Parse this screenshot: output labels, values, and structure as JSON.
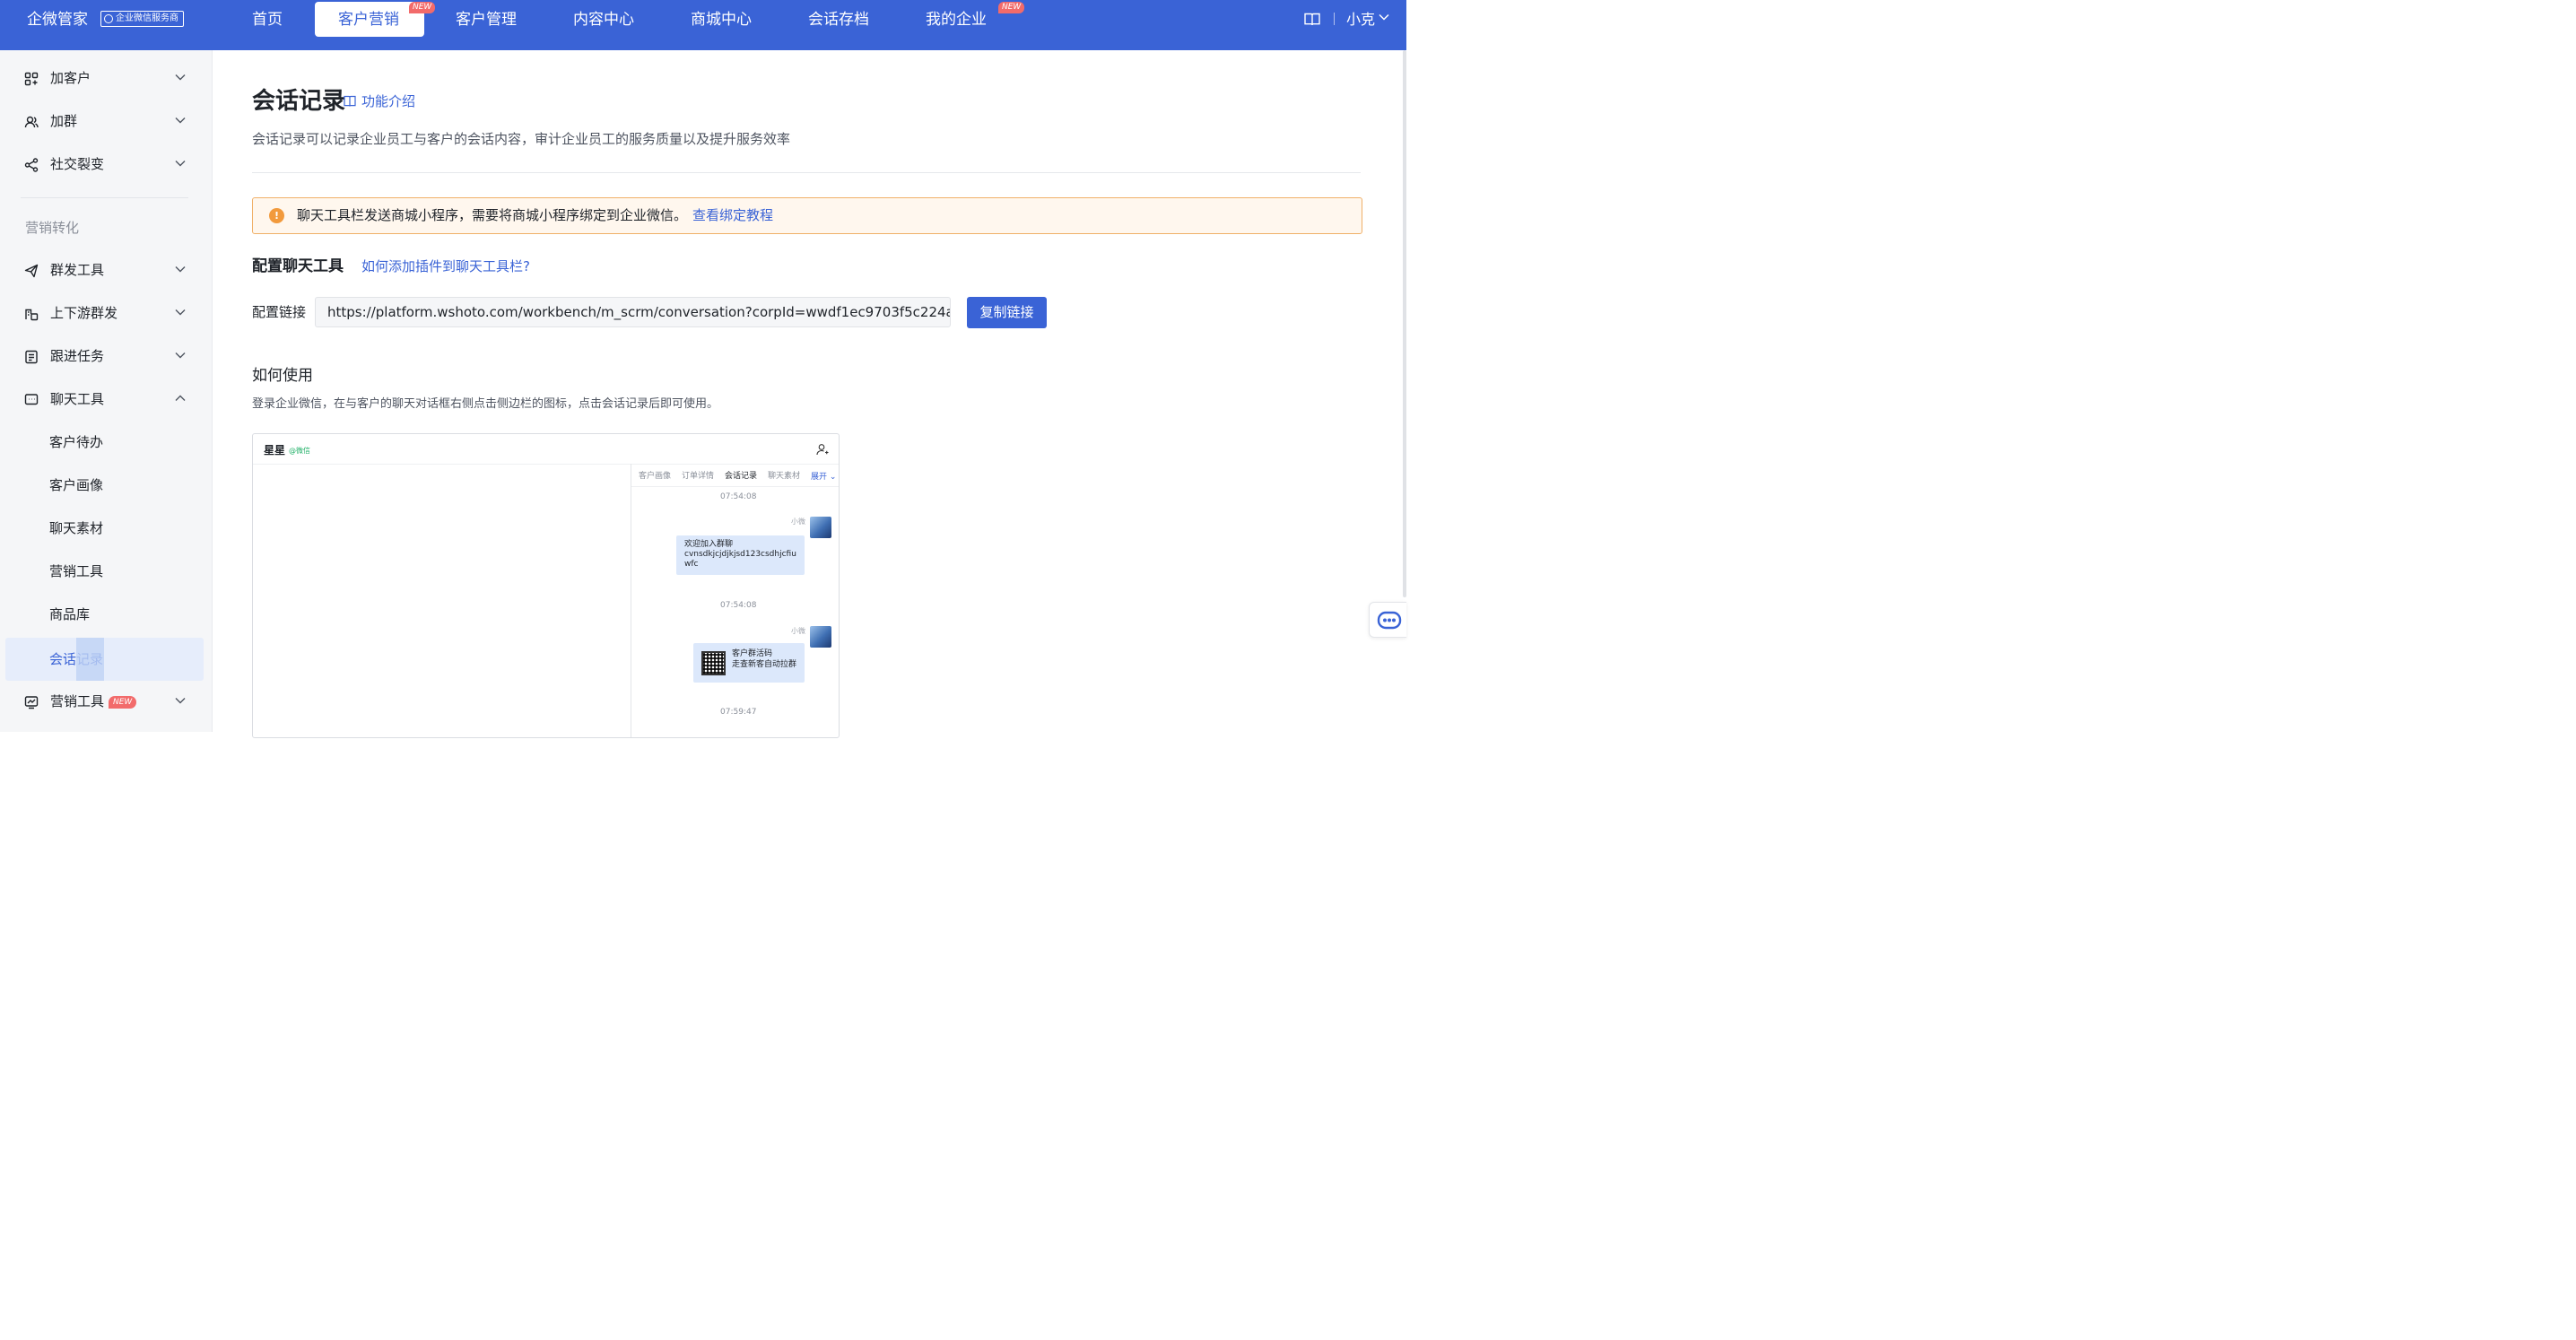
{
  "topbar": {
    "logo": "企微管家",
    "badge": "企业微信服务商",
    "nav": [
      {
        "label": "首页"
      },
      {
        "label": "客户营销",
        "tag": "NEW"
      },
      {
        "label": "客户管理"
      },
      {
        "label": "内容中心"
      },
      {
        "label": "商城中心"
      },
      {
        "label": "会话存档"
      },
      {
        "label": "我的企业",
        "tag": "NEW"
      }
    ],
    "user": "小克",
    "colors": {
      "bar": "#3a63d6",
      "new_tag": "#f26b6b"
    }
  },
  "sidebar": {
    "items": [
      {
        "label": "加客户",
        "icon": "grid-icon"
      },
      {
        "label": "加群",
        "icon": "user-group-icon"
      },
      {
        "label": "社交裂变",
        "icon": "share-icon"
      }
    ],
    "group_title": "营销转化",
    "items2": [
      {
        "label": "群发工具",
        "icon": "send-icon"
      },
      {
        "label": "上下游群发",
        "icon": "chain-icon"
      },
      {
        "label": "跟进任务",
        "icon": "task-icon"
      },
      {
        "label": "聊天工具",
        "icon": "chat-icon"
      }
    ],
    "chat_tools_sub": [
      {
        "label": "客户待办"
      },
      {
        "label": "客户画像"
      },
      {
        "label": "聊天素材"
      },
      {
        "label": "营销工具"
      },
      {
        "label": "商品库"
      },
      {
        "label": "会话记录"
      }
    ],
    "last_item": {
      "label": "营销工具",
      "tag": "NEW",
      "icon": "chart-icon"
    }
  },
  "main": {
    "title": "会话记录",
    "intro_link": "功能介绍",
    "description": "会话记录可以记录企业员工与客户的会话内容，审计企业员工的服务质量以及提升服务效率",
    "notice": {
      "text": "聊天工具栏发送商城小程序，需要将商城小程序绑定到企业微信。",
      "link": "查看绑定教程",
      "color": "#f29a3c"
    },
    "config": {
      "title": "配置聊天工具",
      "help_link": "如何添加插件到聊天工具栏?",
      "label": "配置链接",
      "url": "https://platform.wshoto.com/workbench/m_scrm/conversation?corpId=wwdf1ec9703f5c224a",
      "copy_button": "复制链接"
    },
    "how_to": {
      "title": "如何使用",
      "text": "登录企业微信，在与客户的聊天对话框右侧点击侧边栏的图标，点击会话记录后即可使用。"
    },
    "preview": {
      "contact": "星星",
      "wechat_tag": "@微信",
      "tabs": [
        "客户画像",
        "订单详情",
        "会话记录",
        "聊天素材"
      ],
      "expand": "展开",
      "messages": [
        {
          "time": "07:54:08",
          "sender": "小微",
          "lines": [
            "欢迎加入群聊",
            "cvnsdkjcjdjkjsd123csdhjcfiu",
            "wfc"
          ]
        },
        {
          "time": "07:54:08",
          "sender": "小微",
          "lines": [
            "客户群活码",
            "走查新客自动拉群"
          ]
        },
        {
          "time": "07:59:47"
        }
      ]
    }
  }
}
